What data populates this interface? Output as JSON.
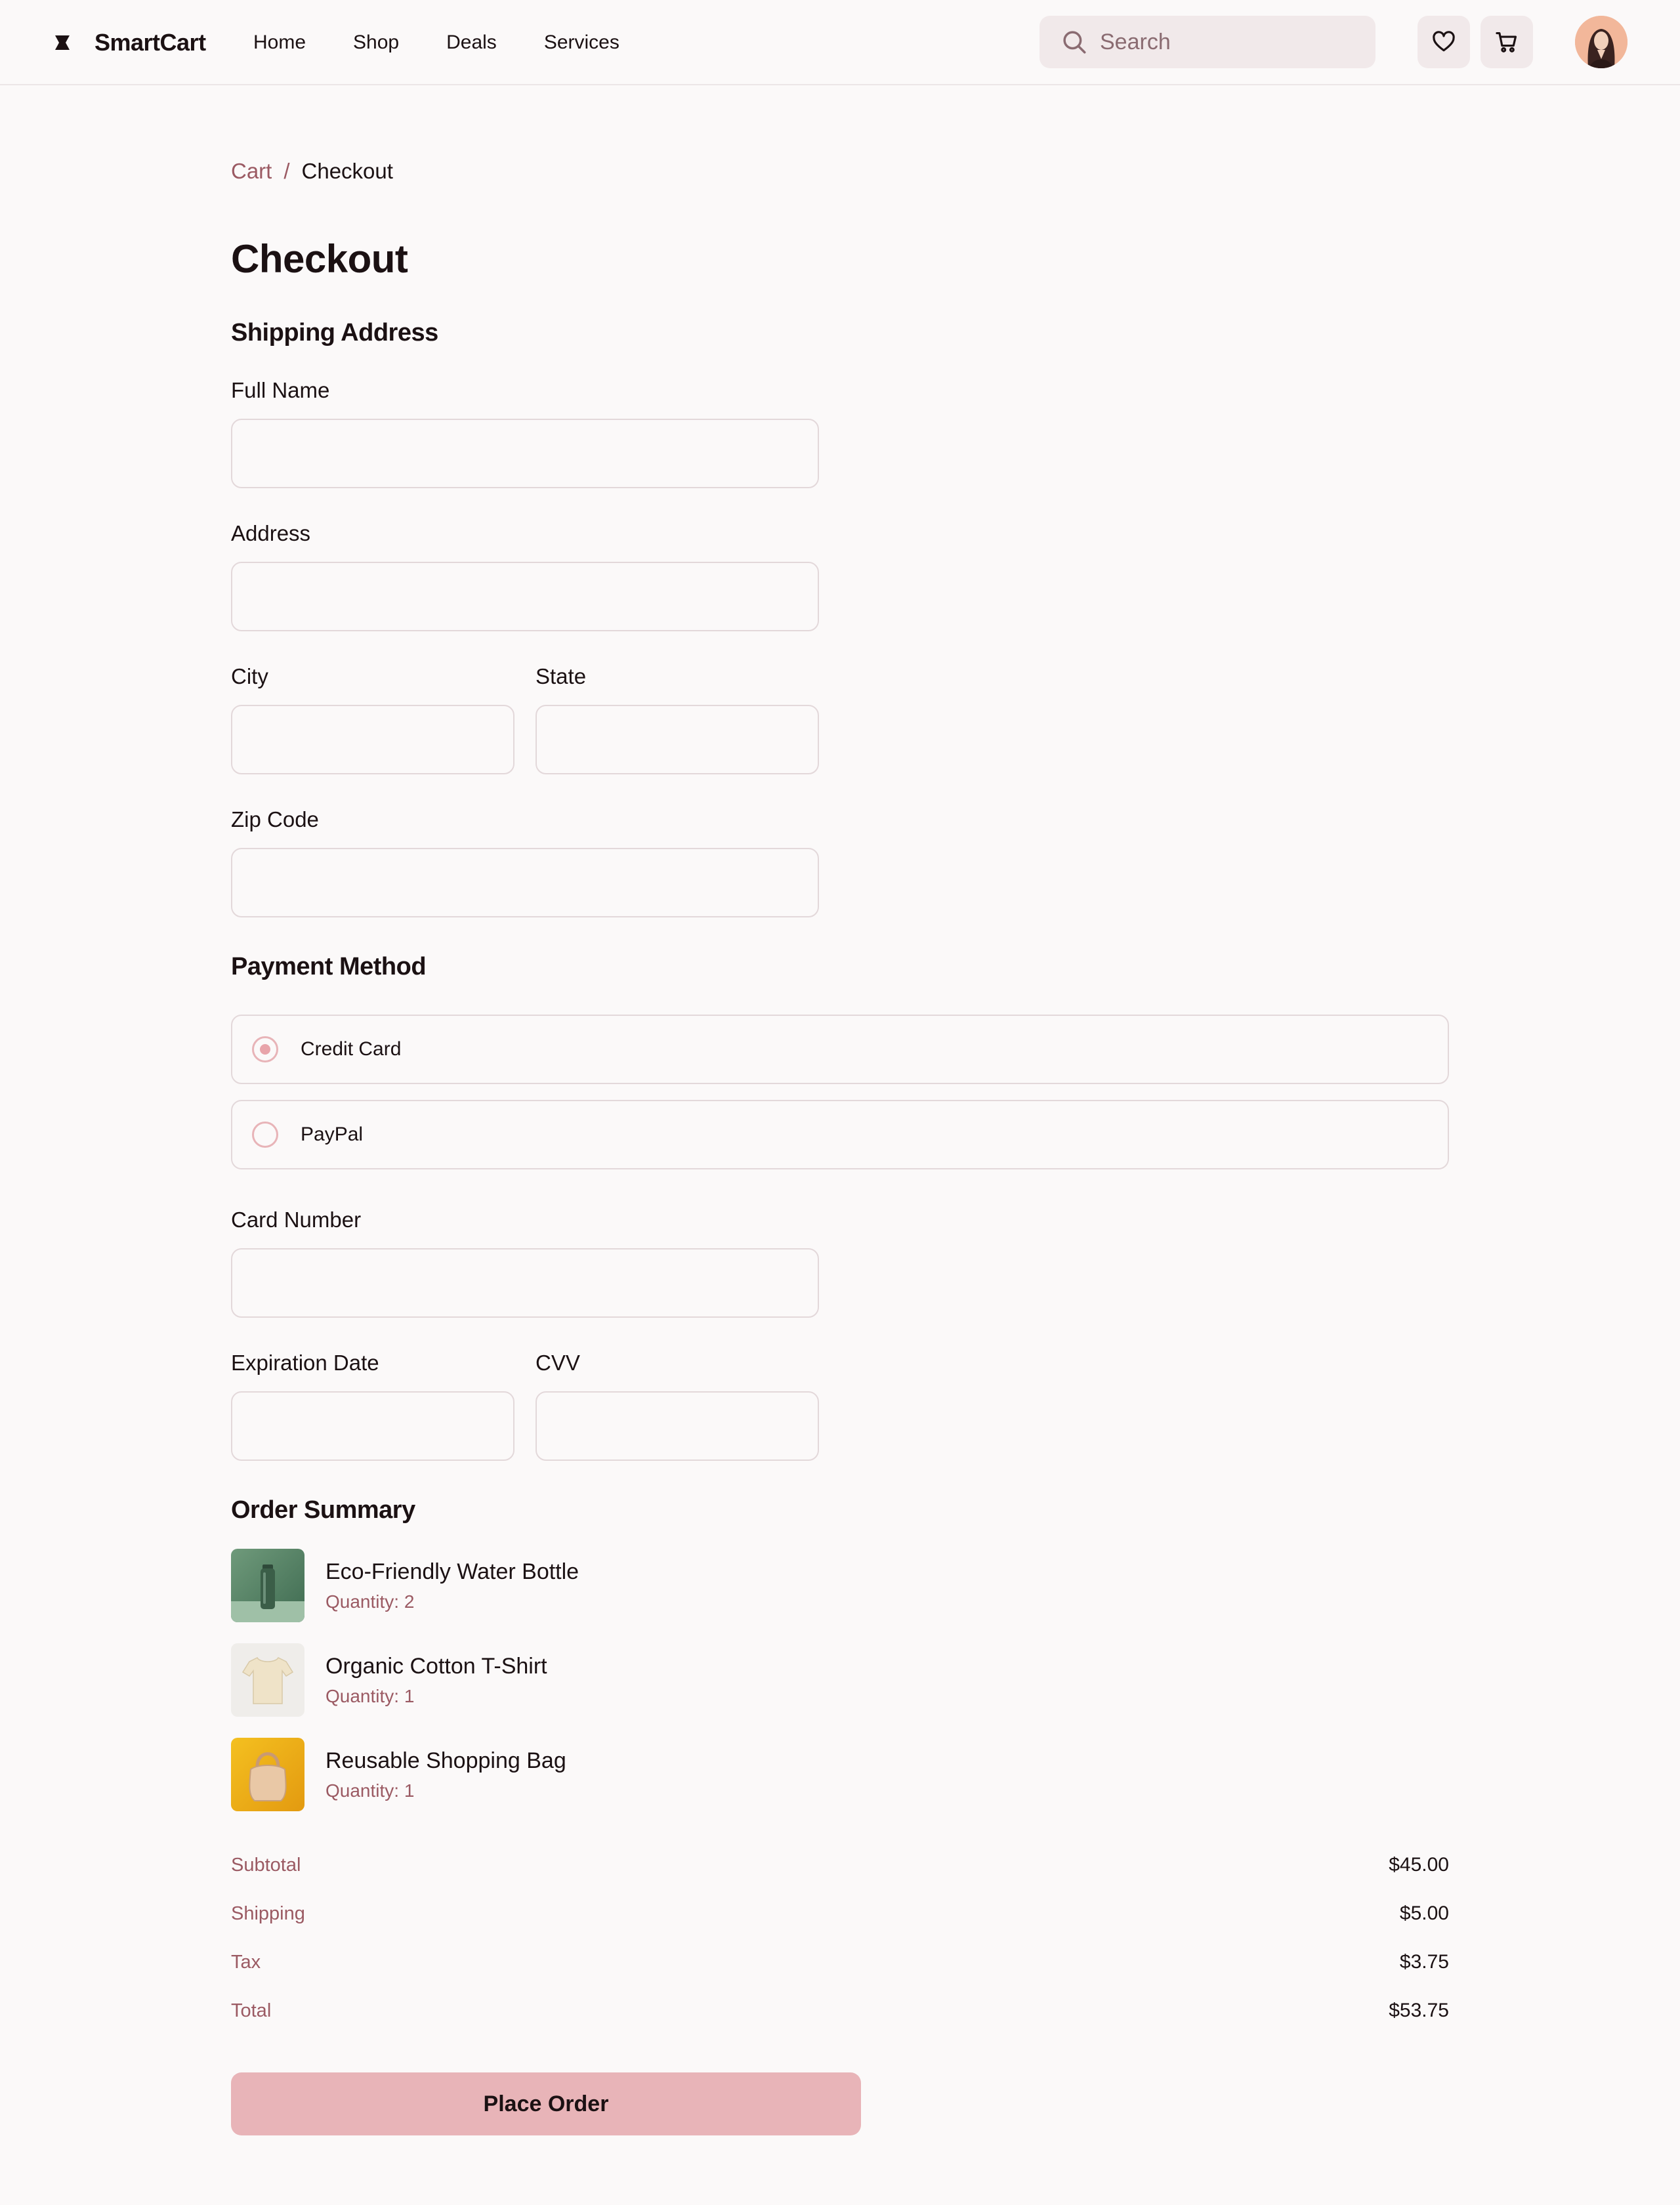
{
  "header": {
    "brand_name": "SmartCart",
    "brand_icon": "logo-icon",
    "nav": [
      "Home",
      "Shop",
      "Deals",
      "Services"
    ],
    "search": {
      "placeholder": "Search",
      "icon": "search-icon"
    },
    "favorites_icon": "heart-icon",
    "cart_icon": "cart-icon",
    "avatar": "user-avatar"
  },
  "breadcrumb": {
    "parent": "Cart",
    "separator": "/",
    "current": "Checkout"
  },
  "page_title": "Checkout",
  "shipping": {
    "title": "Shipping Address",
    "full_name": {
      "label": "Full Name",
      "value": ""
    },
    "address": {
      "label": "Address",
      "value": ""
    },
    "city": {
      "label": "City",
      "value": ""
    },
    "state": {
      "label": "State",
      "value": ""
    },
    "zip": {
      "label": "Zip Code",
      "value": ""
    }
  },
  "payment": {
    "title": "Payment Method",
    "options": [
      {
        "label": "Credit Card",
        "selected": true
      },
      {
        "label": "PayPal",
        "selected": false
      }
    ],
    "card_number": {
      "label": "Card Number",
      "value": ""
    },
    "expiration": {
      "label": "Expiration Date",
      "value": ""
    },
    "cvv": {
      "label": "CVV",
      "value": ""
    }
  },
  "order_summary": {
    "title": "Order Summary",
    "items": [
      {
        "name": "Eco-Friendly Water Bottle",
        "quantity": "Quantity: 2",
        "image": "water-bottle-image"
      },
      {
        "name": "Organic Cotton T-Shirt",
        "quantity": "Quantity: 1",
        "image": "t-shirt-image"
      },
      {
        "name": "Reusable Shopping Bag",
        "quantity": "Quantity: 1",
        "image": "shopping-bag-image"
      }
    ],
    "totals": [
      {
        "label": "Subtotal",
        "value": "$45.00"
      },
      {
        "label": "Shipping",
        "value": "$5.00"
      },
      {
        "label": "Tax",
        "value": "$3.75"
      },
      {
        "label": "Total",
        "value": "$53.75"
      }
    ]
  },
  "place_order_label": "Place Order",
  "colors": {
    "accent": "#e8b4b8",
    "muted_text": "#9b5a63",
    "border": "#e3d8da",
    "background": "#fbf9f9"
  }
}
